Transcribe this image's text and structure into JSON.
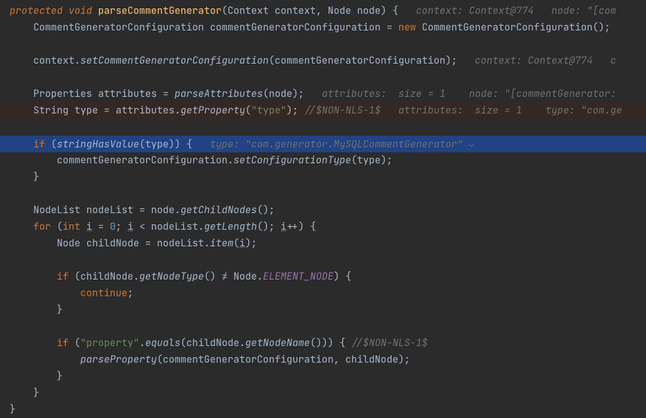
{
  "l1": {
    "kw1": "protected",
    "kw2": "void",
    "mname": "parseCommentGenerator",
    "p1": "(Context context",
    "p2": "Node node) {",
    "h1": "context: Context@774",
    "h2": "node: \"[com"
  },
  "l2": {
    "type": "CommentGeneratorConfiguration",
    "var": "commentGeneratorConfiguration",
    "eq": " = ",
    "kw": "new",
    "ctor": "CommentGeneratorConfiguration();"
  },
  "l3": {
    "a": "context.",
    "m": "setCommentGeneratorConfiguration",
    "b": "(commentGeneratorConfiguration);",
    "h1": "context: Context@774",
    "h2": "c"
  },
  "l4": {
    "type": "Properties",
    "var": "attributes = ",
    "m": "parseAttributes",
    "b": "(node);",
    "h1": "attributes:  size = 1",
    "h2": "node: \"[commentGenerator: "
  },
  "l5": {
    "type": "String",
    "var": "type = attributes.",
    "m": "getProperty",
    "p1": "(",
    "str": "\"type\"",
    "p2": ");",
    "cmt": " //$NON-NLS-1$",
    "h1": "attributes:  size = 1",
    "h2": "type: \"com.ge"
  },
  "l6": {
    "kw": "if",
    "p1": "(",
    "m": "stringHasValue",
    "p2": "(type)) {",
    "h": "type: \"com.generator.MySQLCommentGenerator\""
  },
  "l7": {
    "a": "commentGeneratorConfiguration.",
    "m": "setConfigurationType",
    "b": "(type);"
  },
  "l8": {
    "a": "}"
  },
  "l9": {
    "type": "NodeList",
    "var": "nodeList = node.",
    "m": "getChildNodes",
    "b": "();"
  },
  "l10": {
    "kw1": "for",
    "p1": "(",
    "kw2": "int",
    "v": " ",
    "i1": "i",
    "eq": " = ",
    "n": "0",
    "s1": "; ",
    "i2": "i",
    "s2": " < nodeList.",
    "m": "getLength",
    "s3": "(); ",
    "i3": "i",
    "s4": "++) {"
  },
  "l11": {
    "type": "Node",
    "var": "childNode = nodeList.",
    "m": "item",
    "p1": "(",
    "i": "i",
    "p2": ");"
  },
  "l12": {
    "kw": "if",
    "p1": "(childNode.",
    "m": "getNodeType",
    "p2": "() ≠ Node.",
    "cst": "ELEMENT_NODE",
    "p3": ") {"
  },
  "l13": {
    "kw": "continue",
    "s": ";"
  },
  "l14": {
    "a": "}"
  },
  "l15": {
    "kw": "if",
    "p1": "(",
    "str": "\"property\"",
    "p2": ".",
    "m": "equals",
    "p3": "(childNode.",
    "m2": "getNodeName",
    "p4": "())) { ",
    "cmt": "//$NON-NLS-1$"
  },
  "l16": {
    "m": "parseProperty",
    "b": "(commentGeneratorConfiguration, childNode);"
  },
  "l17": {
    "a": "}"
  },
  "l18": {
    "a": "}"
  },
  "l19": {
    "a": "}"
  }
}
